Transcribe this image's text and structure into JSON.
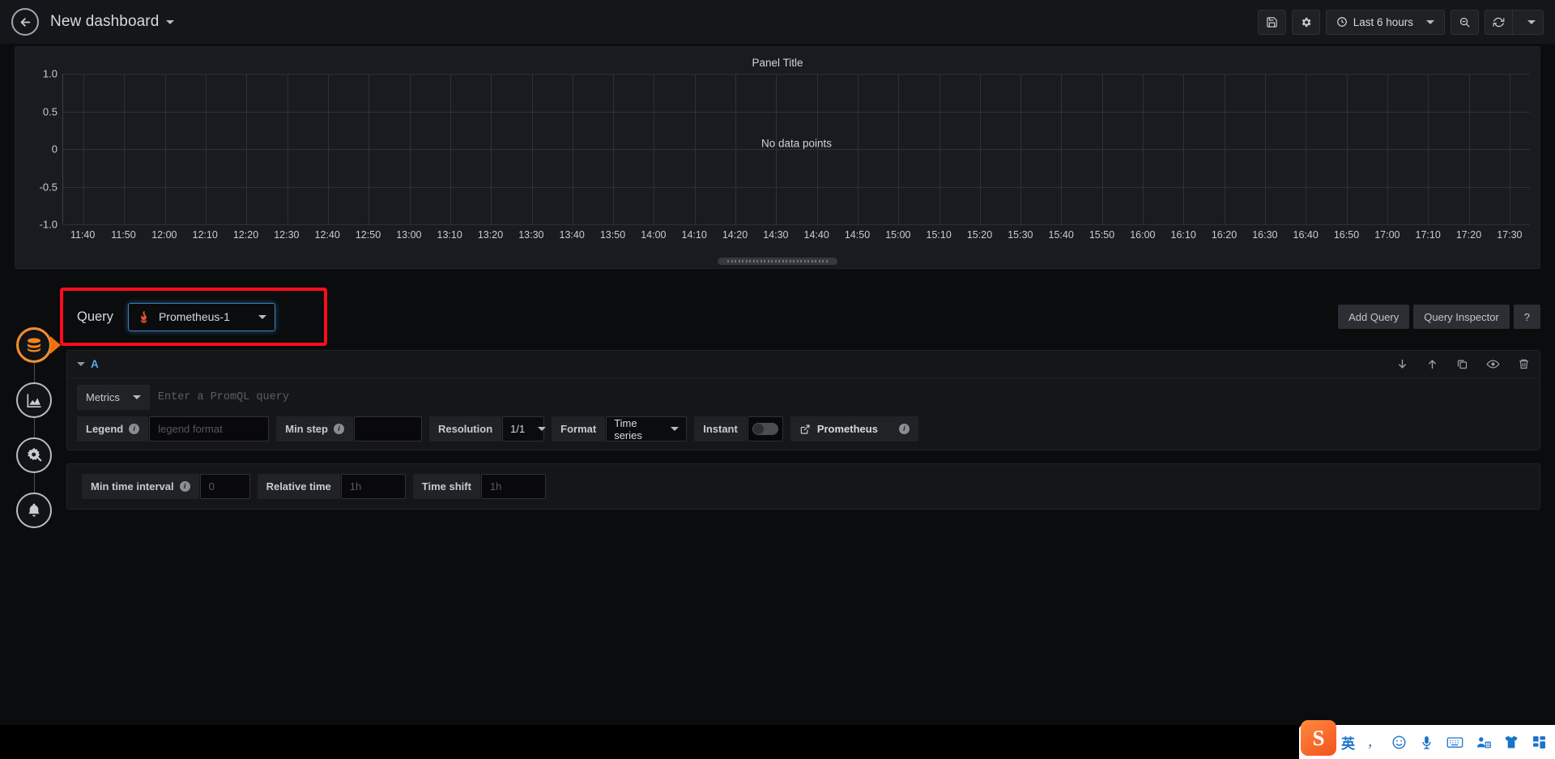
{
  "topnav": {
    "back_icon": "back-arrow-icon",
    "dashboard_title": "New dashboard",
    "save_icon": "save-icon",
    "settings_icon": "gear-icon",
    "time_range": "Last 6 hours",
    "clock_icon": "clock-icon",
    "zoom_out_icon": "zoom-out-icon",
    "refresh_icon": "refresh-icon",
    "refresh_dropdown_icon": "chevron-down-icon"
  },
  "panel": {
    "title": "Panel Title",
    "no_data": "No data points",
    "drag_handle": "panel-resize-handle"
  },
  "chart_data": {
    "type": "line",
    "title": "Panel Title",
    "xlabel": "",
    "ylabel": "",
    "ylim": [
      -1.0,
      1.0
    ],
    "yticks": [
      "1.0",
      "0.5",
      "0",
      "-0.5",
      "-1.0"
    ],
    "ytick_values": [
      1.0,
      0.5,
      0,
      -0.5,
      -1.0
    ],
    "xticks": [
      "11:40",
      "11:50",
      "12:00",
      "12:10",
      "12:20",
      "12:30",
      "12:40",
      "12:50",
      "13:00",
      "13:10",
      "13:20",
      "13:30",
      "13:40",
      "13:50",
      "14:00",
      "14:10",
      "14:20",
      "14:30",
      "14:40",
      "14:50",
      "15:00",
      "15:10",
      "15:20",
      "15:30",
      "15:40",
      "15:50",
      "16:00",
      "16:10",
      "16:20",
      "16:30",
      "16:40",
      "16:50",
      "17:00",
      "17:10",
      "17:20",
      "17:30"
    ],
    "series": [],
    "grid": true,
    "legend_position": "none",
    "annotation": "No data points"
  },
  "edit_tabs": [
    {
      "name": "queries-tab",
      "icon": "database-icon",
      "active": true
    },
    {
      "name": "visualization-tab",
      "icon": "graph-icon",
      "active": false
    },
    {
      "name": "general-tab",
      "icon": "gear-wrench-icon",
      "active": false
    },
    {
      "name": "alert-tab",
      "icon": "bell-icon",
      "active": false
    }
  ],
  "query_header": {
    "label": "Query",
    "datasource": "Prometheus-1",
    "datasource_icon": "prometheus-icon",
    "dropdown_icon": "chevron-down-icon",
    "add_query_label": "Add Query",
    "query_inspector_label": "Query Inspector",
    "help_label": "?",
    "highlight_color": "#fc0d1b"
  },
  "query_row": {
    "ref_id": "A",
    "collapse_icon": "chevron-down-icon",
    "metrics_label": "Metrics",
    "metrics_caret": "chevron-down-icon",
    "promql_placeholder": "Enter a PromQL query",
    "promql_value": "",
    "actions": [
      {
        "name": "move-down-icon",
        "title": "move down"
      },
      {
        "name": "move-up-icon",
        "title": "move up"
      },
      {
        "name": "duplicate-icon",
        "title": "duplicate"
      },
      {
        "name": "eye-icon",
        "title": "toggle visibility"
      },
      {
        "name": "trash-icon",
        "title": "remove"
      }
    ],
    "legend_label": "Legend",
    "legend_placeholder": "legend format",
    "legend_value": "",
    "min_step_label": "Min step",
    "min_step_value": "",
    "resolution_label": "Resolution",
    "resolution_value": "1/1",
    "format_label": "Format",
    "format_value": "Time series",
    "instant_label": "Instant",
    "instant_on": false,
    "prometheus_link_label": "Prometheus",
    "external_link_icon": "external-link-icon",
    "info_icon": "info-icon"
  },
  "options_row": {
    "min_time_interval_label": "Min time interval",
    "min_time_interval_placeholder": "0",
    "min_time_interval_value": "",
    "relative_time_label": "Relative time",
    "relative_time_placeholder": "1h",
    "relative_time_value": "",
    "time_shift_label": "Time shift",
    "time_shift_placeholder": "1h",
    "time_shift_value": ""
  },
  "ime": {
    "logo": "S",
    "mode": "英",
    "punct": "，",
    "emoji_icon": "smiley-icon",
    "voice_icon": "microphone-icon",
    "keyboard_icon": "keyboard-icon",
    "translate_icon": "translate-icon",
    "skin_icon": "shirt-icon",
    "apps_icon": "grid-apps-icon"
  }
}
